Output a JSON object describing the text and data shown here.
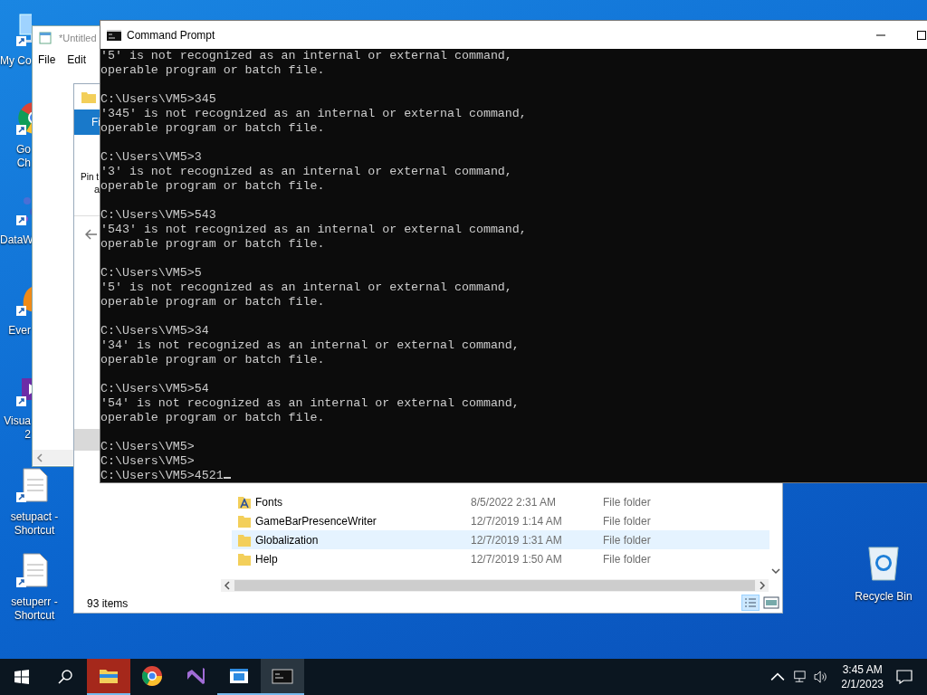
{
  "desktop_icons": [
    {
      "kind": "computer",
      "lines": [
        "My Co"
      ],
      "clipped": true
    },
    {
      "kind": "chrome",
      "lines": [
        "Go",
        "Ch"
      ],
      "clipped": true
    },
    {
      "kind": "network",
      "lines": [
        "DataW"
      ],
      "clipped": true
    },
    {
      "kind": "elephant",
      "lines": [
        "Ever"
      ],
      "clipped": true
    },
    {
      "kind": "studio",
      "lines": [
        "Visua",
        "2"
      ],
      "clipped": true
    },
    {
      "kind": "document",
      "lines": [
        "setupact -",
        "Shortcut"
      ],
      "clipped": false
    },
    {
      "kind": "document",
      "lines": [
        "setuperr -",
        "Shortcut"
      ],
      "clipped": false
    }
  ],
  "recycle_bin": {
    "label": "Recycle Bin"
  },
  "notepad": {
    "title": "*Untitled",
    "menu": [
      "File",
      "Edit"
    ]
  },
  "explorer": {
    "ribbon_tab": {
      "label": "Fi",
      "selected": true
    },
    "ribbon_text": [
      "Pin t",
      "a"
    ],
    "rows": [
      {
        "kind": "fonts",
        "name": "Fonts",
        "date": "8/5/2022 2:31 AM",
        "type": "File folder",
        "selected": false
      },
      {
        "kind": "folder",
        "name": "GameBarPresenceWriter",
        "date": "12/7/2019 1:14 AM",
        "type": "File folder",
        "selected": false
      },
      {
        "kind": "folder",
        "name": "Globalization",
        "date": "12/7/2019 1:31 AM",
        "type": "File folder",
        "selected": true
      },
      {
        "kind": "folder",
        "name": "Help",
        "date": "12/7/2019 1:50 AM",
        "type": "File folder",
        "selected": false
      }
    ],
    "status": "93 items"
  },
  "cmd": {
    "title": "Command Prompt",
    "blocks": [
      [
        "'5' is not recognized as an internal or external command,",
        "operable program or batch file."
      ],
      [
        "C:\\Users\\VM5>345",
        "'345' is not recognized as an internal or external command,",
        "operable program or batch file."
      ],
      [
        "C:\\Users\\VM5>3",
        "'3' is not recognized as an internal or external command,",
        "operable program or batch file."
      ],
      [
        "C:\\Users\\VM5>543",
        "'543' is not recognized as an internal or external command,",
        "operable program or batch file."
      ],
      [
        "C:\\Users\\VM5>5",
        "'5' is not recognized as an internal or external command,",
        "operable program or batch file."
      ],
      [
        "C:\\Users\\VM5>34",
        "'34' is not recognized as an internal or external command,",
        "operable program or batch file."
      ],
      [
        "C:\\Users\\VM5>54",
        "'54' is not recognized as an internal or external command,",
        "operable program or batch file."
      ],
      [
        "C:\\Users\\VM5>",
        "C:\\Users\\VM5>",
        "C:\\Users\\VM5>4521"
      ]
    ]
  },
  "taskbar": {
    "apps": [
      {
        "kind": "explorer",
        "selected": false,
        "flashing": true,
        "running": true
      },
      {
        "kind": "chrome",
        "selected": false,
        "flashing": false,
        "running": false
      },
      {
        "kind": "studio",
        "selected": false,
        "flashing": false,
        "running": false
      },
      {
        "kind": "window",
        "selected": false,
        "flashing": false,
        "running": true
      },
      {
        "kind": "console",
        "selected": true,
        "flashing": false,
        "running": true
      }
    ],
    "time": "3:45 AM",
    "date": "2/1/2023"
  }
}
